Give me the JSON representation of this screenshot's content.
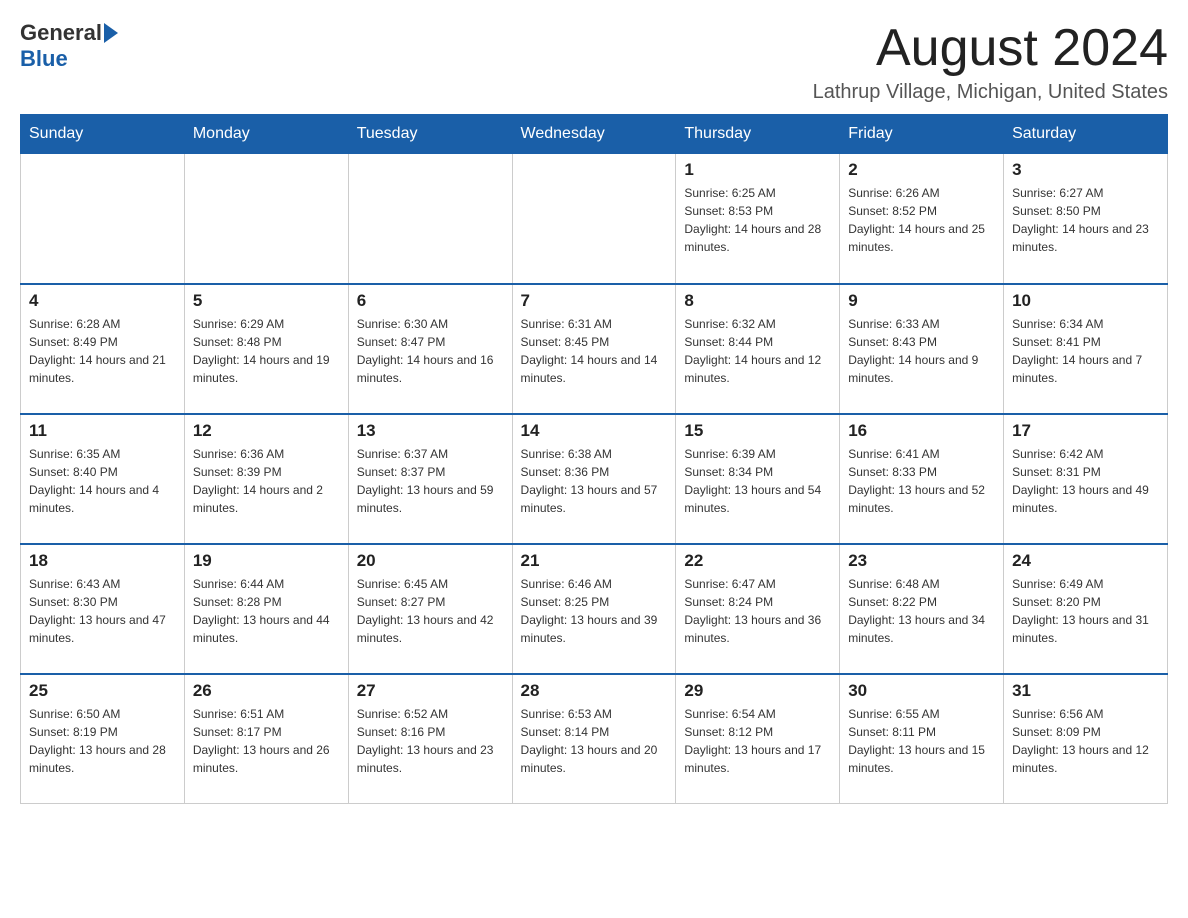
{
  "logo": {
    "general": "General",
    "blue": "Blue"
  },
  "header": {
    "title": "August 2024",
    "subtitle": "Lathrup Village, Michigan, United States"
  },
  "weekdays": [
    "Sunday",
    "Monday",
    "Tuesday",
    "Wednesday",
    "Thursday",
    "Friday",
    "Saturday"
  ],
  "weeks": [
    [
      {
        "day": "",
        "info": ""
      },
      {
        "day": "",
        "info": ""
      },
      {
        "day": "",
        "info": ""
      },
      {
        "day": "",
        "info": ""
      },
      {
        "day": "1",
        "info": "Sunrise: 6:25 AM\nSunset: 8:53 PM\nDaylight: 14 hours and 28 minutes."
      },
      {
        "day": "2",
        "info": "Sunrise: 6:26 AM\nSunset: 8:52 PM\nDaylight: 14 hours and 25 minutes."
      },
      {
        "day": "3",
        "info": "Sunrise: 6:27 AM\nSunset: 8:50 PM\nDaylight: 14 hours and 23 minutes."
      }
    ],
    [
      {
        "day": "4",
        "info": "Sunrise: 6:28 AM\nSunset: 8:49 PM\nDaylight: 14 hours and 21 minutes."
      },
      {
        "day": "5",
        "info": "Sunrise: 6:29 AM\nSunset: 8:48 PM\nDaylight: 14 hours and 19 minutes."
      },
      {
        "day": "6",
        "info": "Sunrise: 6:30 AM\nSunset: 8:47 PM\nDaylight: 14 hours and 16 minutes."
      },
      {
        "day": "7",
        "info": "Sunrise: 6:31 AM\nSunset: 8:45 PM\nDaylight: 14 hours and 14 minutes."
      },
      {
        "day": "8",
        "info": "Sunrise: 6:32 AM\nSunset: 8:44 PM\nDaylight: 14 hours and 12 minutes."
      },
      {
        "day": "9",
        "info": "Sunrise: 6:33 AM\nSunset: 8:43 PM\nDaylight: 14 hours and 9 minutes."
      },
      {
        "day": "10",
        "info": "Sunrise: 6:34 AM\nSunset: 8:41 PM\nDaylight: 14 hours and 7 minutes."
      }
    ],
    [
      {
        "day": "11",
        "info": "Sunrise: 6:35 AM\nSunset: 8:40 PM\nDaylight: 14 hours and 4 minutes."
      },
      {
        "day": "12",
        "info": "Sunrise: 6:36 AM\nSunset: 8:39 PM\nDaylight: 14 hours and 2 minutes."
      },
      {
        "day": "13",
        "info": "Sunrise: 6:37 AM\nSunset: 8:37 PM\nDaylight: 13 hours and 59 minutes."
      },
      {
        "day": "14",
        "info": "Sunrise: 6:38 AM\nSunset: 8:36 PM\nDaylight: 13 hours and 57 minutes."
      },
      {
        "day": "15",
        "info": "Sunrise: 6:39 AM\nSunset: 8:34 PM\nDaylight: 13 hours and 54 minutes."
      },
      {
        "day": "16",
        "info": "Sunrise: 6:41 AM\nSunset: 8:33 PM\nDaylight: 13 hours and 52 minutes."
      },
      {
        "day": "17",
        "info": "Sunrise: 6:42 AM\nSunset: 8:31 PM\nDaylight: 13 hours and 49 minutes."
      }
    ],
    [
      {
        "day": "18",
        "info": "Sunrise: 6:43 AM\nSunset: 8:30 PM\nDaylight: 13 hours and 47 minutes."
      },
      {
        "day": "19",
        "info": "Sunrise: 6:44 AM\nSunset: 8:28 PM\nDaylight: 13 hours and 44 minutes."
      },
      {
        "day": "20",
        "info": "Sunrise: 6:45 AM\nSunset: 8:27 PM\nDaylight: 13 hours and 42 minutes."
      },
      {
        "day": "21",
        "info": "Sunrise: 6:46 AM\nSunset: 8:25 PM\nDaylight: 13 hours and 39 minutes."
      },
      {
        "day": "22",
        "info": "Sunrise: 6:47 AM\nSunset: 8:24 PM\nDaylight: 13 hours and 36 minutes."
      },
      {
        "day": "23",
        "info": "Sunrise: 6:48 AM\nSunset: 8:22 PM\nDaylight: 13 hours and 34 minutes."
      },
      {
        "day": "24",
        "info": "Sunrise: 6:49 AM\nSunset: 8:20 PM\nDaylight: 13 hours and 31 minutes."
      }
    ],
    [
      {
        "day": "25",
        "info": "Sunrise: 6:50 AM\nSunset: 8:19 PM\nDaylight: 13 hours and 28 minutes."
      },
      {
        "day": "26",
        "info": "Sunrise: 6:51 AM\nSunset: 8:17 PM\nDaylight: 13 hours and 26 minutes."
      },
      {
        "day": "27",
        "info": "Sunrise: 6:52 AM\nSunset: 8:16 PM\nDaylight: 13 hours and 23 minutes."
      },
      {
        "day": "28",
        "info": "Sunrise: 6:53 AM\nSunset: 8:14 PM\nDaylight: 13 hours and 20 minutes."
      },
      {
        "day": "29",
        "info": "Sunrise: 6:54 AM\nSunset: 8:12 PM\nDaylight: 13 hours and 17 minutes."
      },
      {
        "day": "30",
        "info": "Sunrise: 6:55 AM\nSunset: 8:11 PM\nDaylight: 13 hours and 15 minutes."
      },
      {
        "day": "31",
        "info": "Sunrise: 6:56 AM\nSunset: 8:09 PM\nDaylight: 13 hours and 12 minutes."
      }
    ]
  ]
}
